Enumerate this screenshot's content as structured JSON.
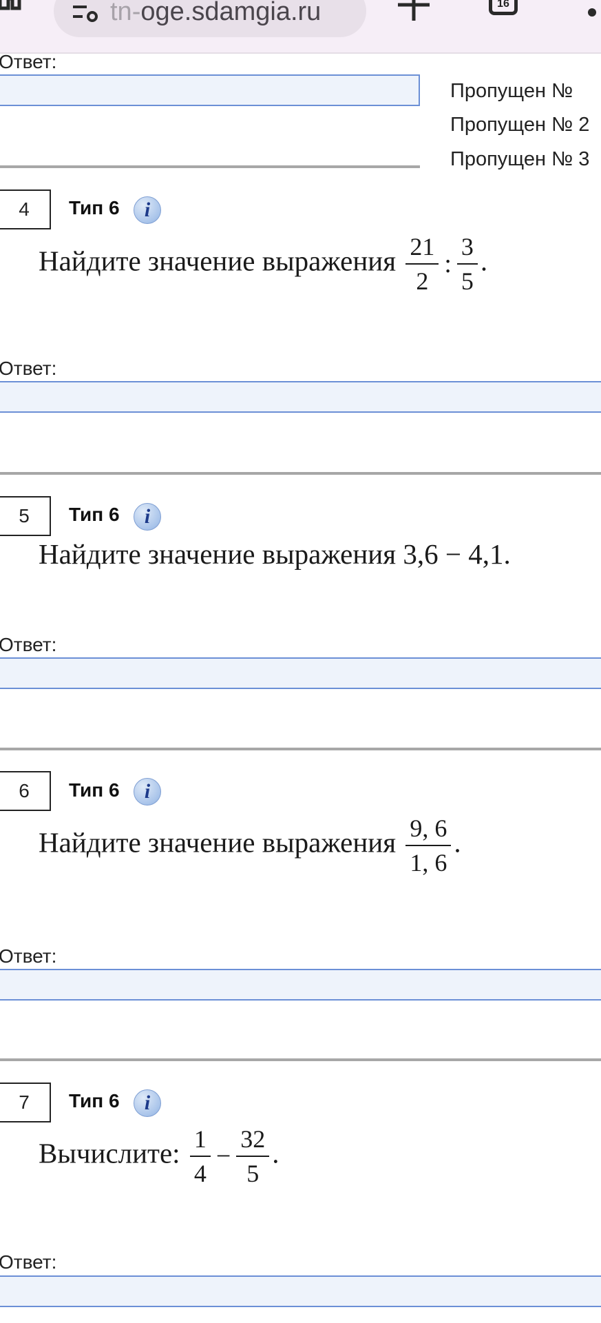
{
  "browser": {
    "url_faded": "tn-",
    "url_main": "oge.sdamgia.ru",
    "tab_count": "16"
  },
  "skipped": [
    "Пропущен №",
    "Пропущен № 2",
    "Пропущен № 3"
  ],
  "answer_label": "Ответ:",
  "problems": [
    {
      "number": "4",
      "type": "Тип 6",
      "text": "Найдите значение выражения",
      "f1_num": "21",
      "f1_den": "2",
      "op": ":",
      "f2_num": "3",
      "f2_den": "5",
      "end": "."
    },
    {
      "number": "5",
      "type": "Тип 6",
      "text": "Найдите значение выражения 3,6 − 4,1."
    },
    {
      "number": "6",
      "type": "Тип 6",
      "text": "Найдите значение выражения",
      "f1_num": "9, 6",
      "f1_den": "1, 6",
      "end": "."
    },
    {
      "number": "7",
      "type": "Тип 6",
      "text": "Вычислите:",
      "f1_num": "1",
      "f1_den": "4",
      "op": "−",
      "f2_num": "32",
      "f2_den": "5",
      "end": "."
    }
  ],
  "info_icon_glyph": "i",
  "colors": {
    "answer_border": "#6b8fd6",
    "answer_fill": "#eef3fb",
    "divider": "#a7a7a7",
    "browser_bar": "#f6eef7"
  }
}
